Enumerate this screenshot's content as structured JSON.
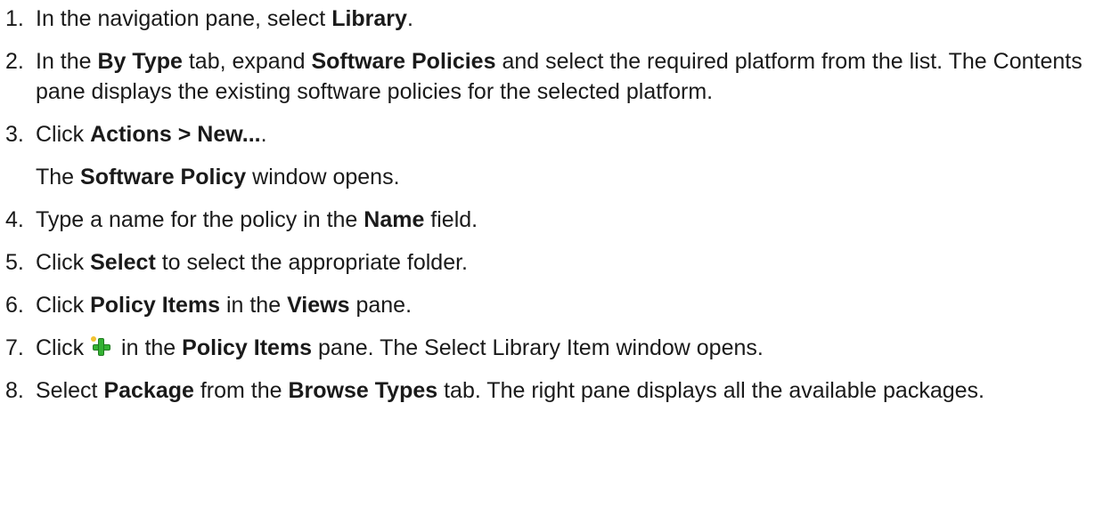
{
  "steps": [
    {
      "number": "1.",
      "parts": [
        "In the navigation pane, select ",
        "Library",
        "."
      ]
    },
    {
      "number": "2.",
      "parts": [
        "In the ",
        "By Type",
        " tab, expand ",
        "Software Policies",
        " and select the required platform from the list. The Contents pane displays the existing software policies for the selected platform."
      ]
    },
    {
      "number": "3.",
      "parts": [
        "Click ",
        "Actions > New...",
        "."
      ],
      "sub_parts": [
        "The ",
        "Software Policy",
        " window opens."
      ]
    },
    {
      "number": "4.",
      "parts": [
        "Type a name for the policy in the ",
        "Name",
        " field."
      ]
    },
    {
      "number": "5.",
      "parts": [
        "Click ",
        "Select",
        " to select the appropriate folder."
      ]
    },
    {
      "number": "6.",
      "parts": [
        "Click ",
        "Policy Items",
        " in the ",
        "Views",
        " pane."
      ]
    },
    {
      "number": "7.",
      "parts": [
        "Click ",
        " in the ",
        "Policy Items",
        " pane. The Select Library Item window opens."
      ],
      "icon": "add-plus-icon"
    },
    {
      "number": "8.",
      "parts": [
        "Select ",
        "Package",
        " from the ",
        "Browse Types",
        " tab. The right pane displays all the available packages."
      ]
    }
  ]
}
